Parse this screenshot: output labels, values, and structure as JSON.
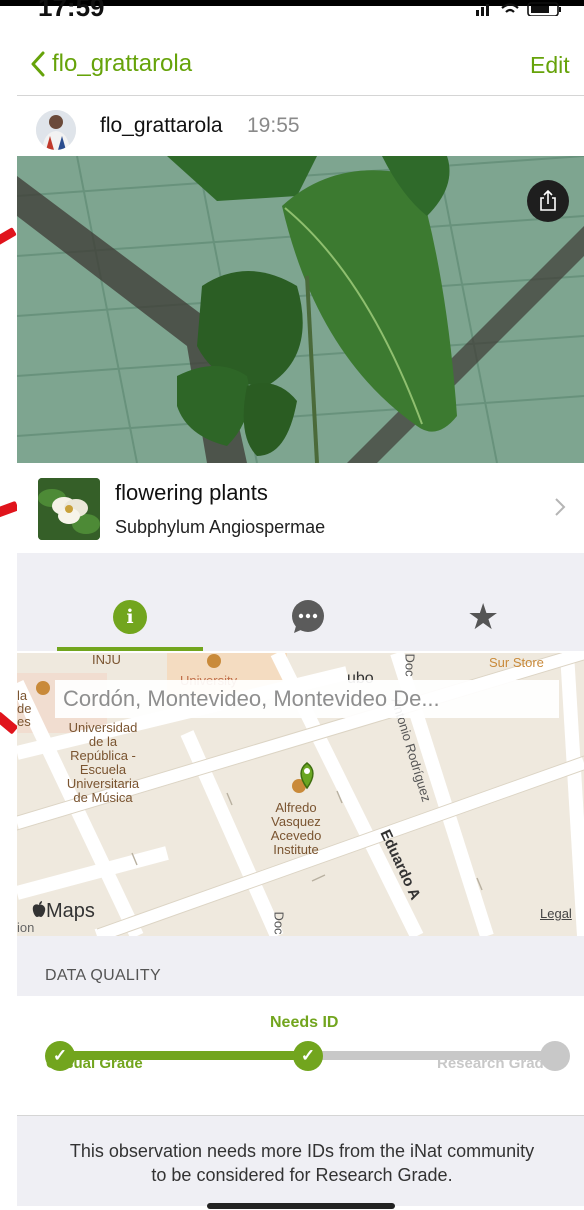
{
  "status_bar": {
    "time": "17:59"
  },
  "nav": {
    "back_label": "flo_grattarola",
    "edit_label": "Edit"
  },
  "observation": {
    "username": "flo_grattarola",
    "time": "19:55"
  },
  "taxon": {
    "common_name": "flowering plants",
    "scientific_name": "Subphylum Angiospermae"
  },
  "tabs": [
    {
      "name": "info",
      "glyph": "i"
    },
    {
      "name": "activity",
      "icon": "speech-bubble-icon"
    },
    {
      "name": "favorites",
      "glyph": "★"
    }
  ],
  "map": {
    "location_placeholder": "Cordón, Montevideo, Montevideo De...",
    "labels": {
      "inju": "INJU",
      "university": "University",
      "ubo": "ubo",
      "sur_store": "Sur Store",
      "la": "la",
      "de": "de",
      "es": "es",
      "escuela": "Universidad\nde la\nRepública -\nEscuela\nUniversitaria\nde Música",
      "institute": "Alfredo\nVasquez\nAcevedo\nInstitute",
      "street_antonio": "Antonio Rodríguez",
      "street_doc": "Doc",
      "street_doc2": "Doc",
      "street_eduardo": "Eduardo A",
      "ion": "ion"
    },
    "attribution": "Maps",
    "legal": "Legal"
  },
  "data_quality": {
    "title": "DATA QUALITY",
    "current": "Needs ID",
    "start": "Casual Grade",
    "end": "Research Grade",
    "progress": 0.5,
    "note": "This observation needs more IDs from the iNat community to be considered for Research Grade."
  },
  "colors": {
    "accent": "#72a51e",
    "inactive": "#c8c8c8",
    "nav_green": "#66a30a"
  }
}
